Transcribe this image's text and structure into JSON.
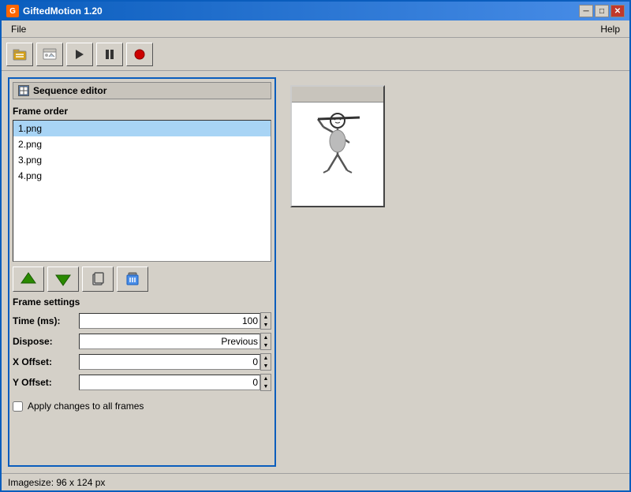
{
  "window": {
    "title": "GiftedMotion 1.20",
    "title_icon": "G",
    "buttons": {
      "minimize": "─",
      "maximize": "□",
      "close": "✕"
    }
  },
  "menu": {
    "file_label": "File",
    "help_label": "Help"
  },
  "toolbar": {
    "open_icon": "📂",
    "image_icon": "🖼",
    "play_icon": "▶",
    "pause_icon": "⏸",
    "record_icon": "⏺"
  },
  "sequence_editor": {
    "title": "Sequence editor",
    "frame_order_label": "Frame order",
    "frames": [
      {
        "name": "1.png",
        "selected": true
      },
      {
        "name": "2.png",
        "selected": false
      },
      {
        "name": "3.png",
        "selected": false
      },
      {
        "name": "4.png",
        "selected": false
      }
    ]
  },
  "frame_settings": {
    "title": "Frame settings",
    "time_label": "Time (ms):",
    "time_value": "100",
    "dispose_label": "Dispose:",
    "dispose_value": "Previous",
    "x_offset_label": "X Offset:",
    "x_offset_value": "0",
    "y_offset_label": "Y Offset:",
    "y_offset_value": "0",
    "apply_label": "Apply changes to all frames"
  },
  "status_bar": {
    "text": "Imagesize: 96 x 124 px"
  },
  "buttons": {
    "up_arrow": "↑",
    "down_arrow": "↓",
    "copy": "⧉",
    "delete": "🗑"
  }
}
